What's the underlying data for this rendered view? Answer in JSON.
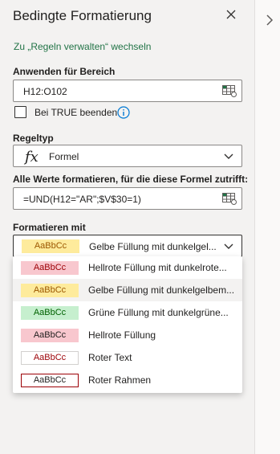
{
  "panel": {
    "title": "Bedingte Formatierung",
    "switch_link": "Zu „Regeln verwalten“ wechseln"
  },
  "range": {
    "label": "Anwenden für Bereich",
    "value": "H12:O102"
  },
  "stop_if_true": {
    "label": "Bei TRUE beenden",
    "checked": false
  },
  "rule_type": {
    "label": "Regeltyp",
    "value": "Formel"
  },
  "formula": {
    "label": "Alle Werte formatieren, für die diese Formel zutrifft:",
    "value": "=UND(H12=\"AR\";$V$30=1)"
  },
  "format": {
    "label": "Formatieren mit",
    "selected_sample": "AaBbCc",
    "selected_label": "Gelbe Füllung mit dunkelgel...",
    "options": [
      {
        "sample": "AaBbCc",
        "label": "Hellrote Füllung mit dunkelrote...",
        "fill": "#f8c7ce",
        "text": "#9c0006",
        "border": "#f8c7ce"
      },
      {
        "sample": "AaBbCc",
        "label": "Gelbe Füllung mit dunkelgelbem...",
        "fill": "#feeb9c",
        "text": "#9c5700",
        "border": "#feeb9c"
      },
      {
        "sample": "AaBbCc",
        "label": "Grüne Füllung mit dunkelgrüne...",
        "fill": "#c6efce",
        "text": "#006100",
        "border": "#c6efce"
      },
      {
        "sample": "AaBbCc",
        "label": "Hellrote Füllung",
        "fill": "#f8c7ce",
        "text": "#201f1e",
        "border": "#f8c7ce"
      },
      {
        "sample": "AaBbCc",
        "label": "Roter Text",
        "fill": "#ffffff",
        "text": "#9c0006",
        "border": "#d2d0ce"
      },
      {
        "sample": "AaBbCc",
        "label": "Roter Rahmen",
        "fill": "#ffffff",
        "text": "#201f1e",
        "border": "#9c0006"
      }
    ]
  },
  "colors": {
    "link": "#217346",
    "selected_fill": "#feeb9c",
    "selected_text": "#9c5700"
  },
  "icons": {
    "close": "close-icon",
    "info": "info-icon",
    "range_selector": "range-selector-icon",
    "function": "fx-icon",
    "chevron_down": "chevron-down-icon",
    "collapse": "chevron-right-icon"
  }
}
